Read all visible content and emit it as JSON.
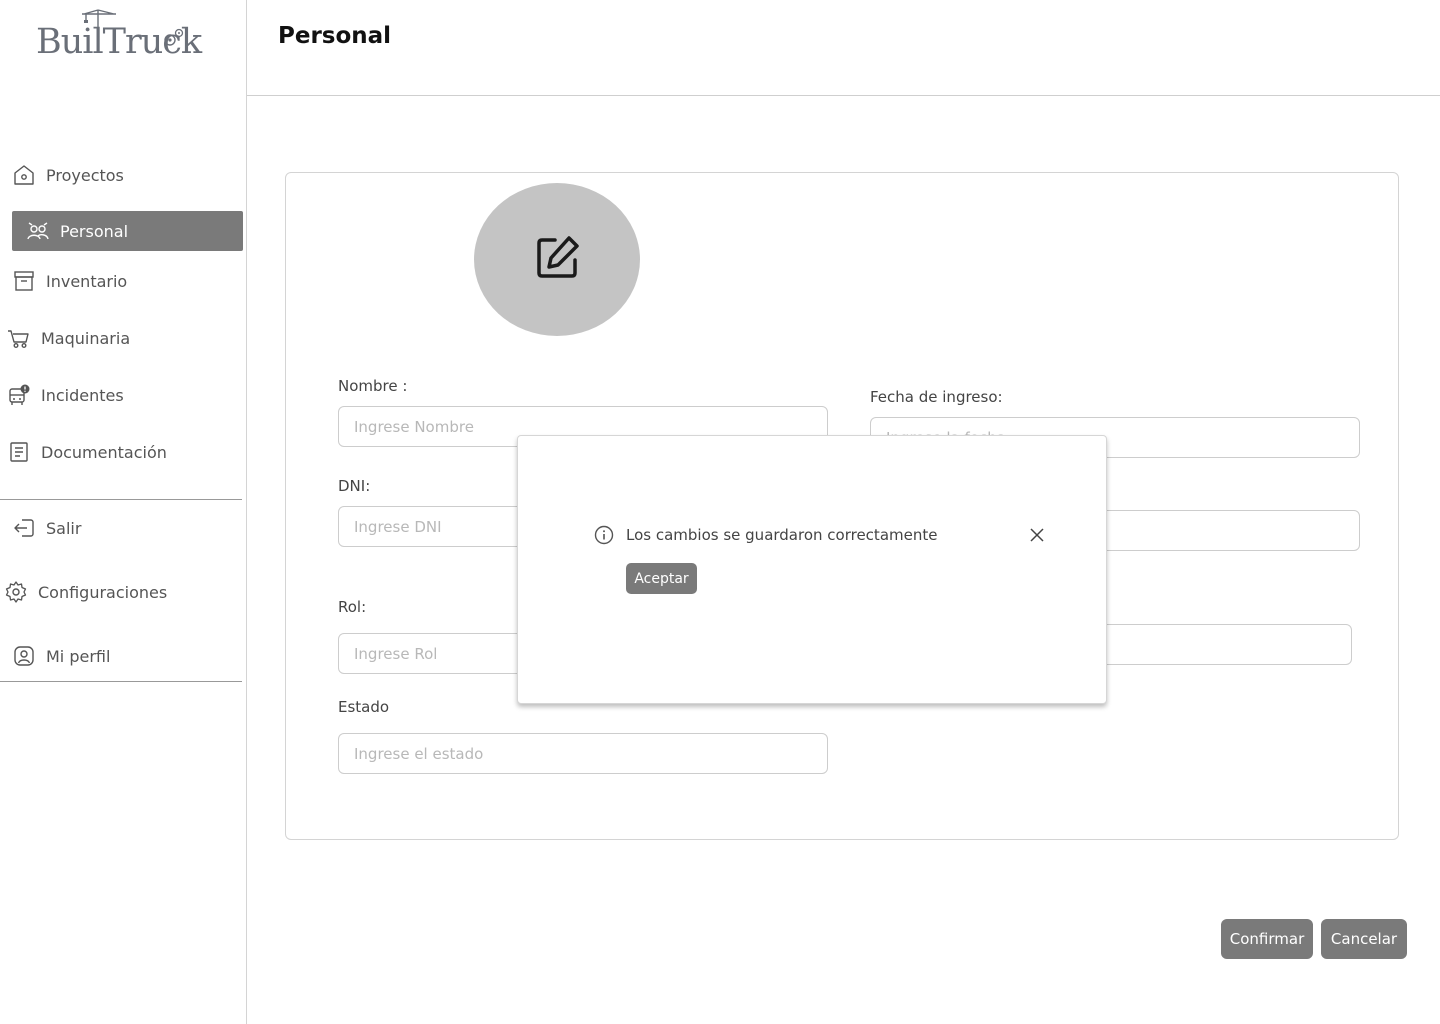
{
  "brand": {
    "logo_text": "BuilTruck"
  },
  "sidebar": {
    "items": [
      {
        "label": "Proyectos",
        "icon": "home-icon"
      },
      {
        "label": "Personal",
        "icon": "people-icon",
        "active": true
      },
      {
        "label": "Inventario",
        "icon": "archive-icon"
      },
      {
        "label": "Maquinaria",
        "icon": "cart-icon"
      },
      {
        "label": "Incidentes",
        "icon": "truck-alert-icon"
      },
      {
        "label": "Documentación",
        "icon": "document-icon"
      }
    ],
    "bottom_items": [
      {
        "label": "Salir",
        "icon": "logout-icon"
      },
      {
        "label": "Configuraciones",
        "icon": "gear-icon"
      },
      {
        "label": "Mi perfil",
        "icon": "user-icon"
      }
    ]
  },
  "header": {
    "title": "Personal"
  },
  "form": {
    "avatar_icon": "edit-icon",
    "nombre": {
      "label": "Nombre :",
      "placeholder": "Ingrese Nombre"
    },
    "fecha_ingreso": {
      "label": "Fecha de ingreso:",
      "placeholder": "Ingrese la fecha"
    },
    "dni": {
      "label": "DNI:",
      "placeholder": "Ingrese DNI"
    },
    "rol": {
      "label": "Rol:",
      "placeholder": "Ingrese Rol"
    },
    "estado": {
      "label": "Estado",
      "placeholder": "Ingrese el estado"
    }
  },
  "modal": {
    "icon": "info-icon",
    "message": "Los cambios se guardaron correctamente",
    "accept_label": "Aceptar",
    "close_icon": "close-icon"
  },
  "actions": {
    "confirm_label": "Confirmar",
    "cancel_label": "Cancelar"
  },
  "colors": {
    "primary_button": "#7a7a7a",
    "avatar_bg": "#c4c4c4",
    "border": "#d4d4d4"
  }
}
